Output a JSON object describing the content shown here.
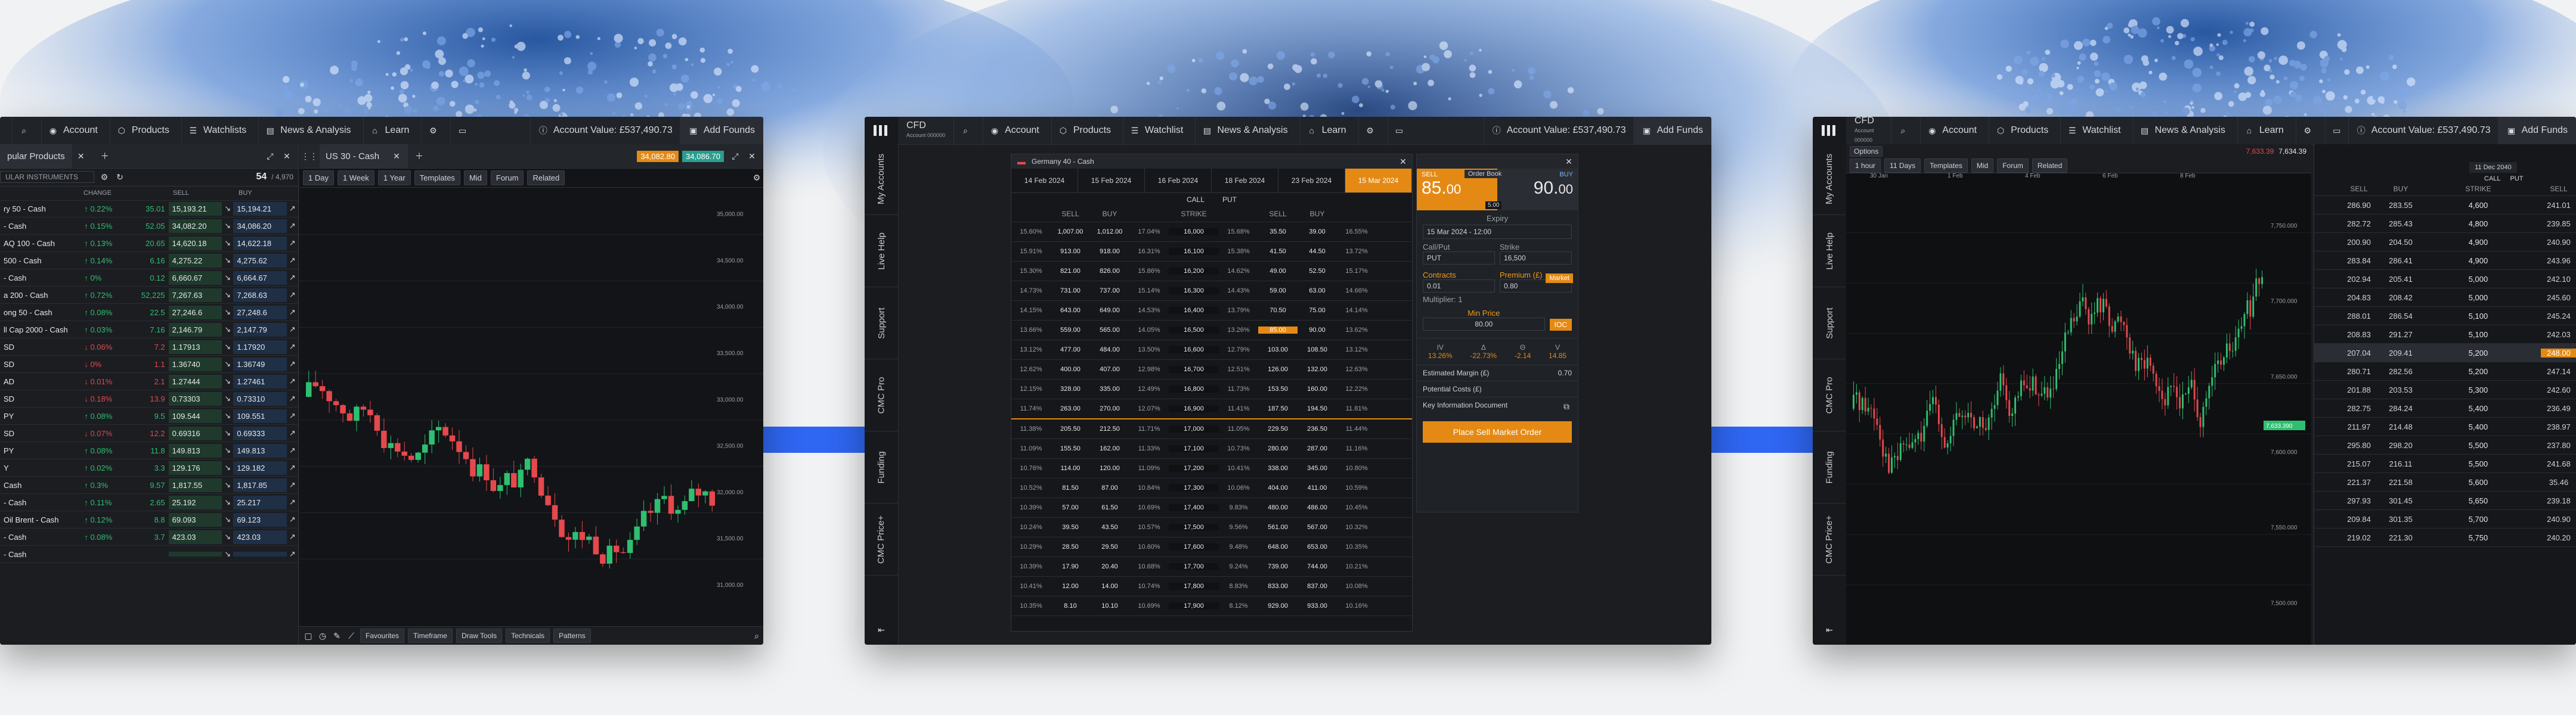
{
  "colors": {
    "background": "#f1f2f3",
    "band": "#2f66f2",
    "screen_bg": "#1b1d21",
    "up": "#2fbf71",
    "down": "#e5484d",
    "accent_orange": "#e48a14"
  },
  "icons": [
    "search-icon",
    "user-icon",
    "box-icon",
    "list-icon",
    "news-icon",
    "graduation-icon",
    "gear-icon",
    "monitor-icon",
    "info-icon",
    "funds-icon",
    "close-icon",
    "plus-icon",
    "expand-icon",
    "collapse-icon"
  ],
  "screens": {
    "left": {
      "nav": {
        "account": "Account",
        "products": "Products",
        "watchlists": "Watchlists",
        "news": "News & Analysis",
        "learn": "Learn",
        "account_value_label": "Account Value: £537,490.73",
        "add_funds": "Add Founds"
      },
      "watchlist": {
        "title": "pular Products",
        "filter": "ULAR INSTRUMENTS",
        "count": "54",
        "count_total": "/ 4,970",
        "col_change": "CHANGE",
        "col_sell": "SELL",
        "col_buy": "BUY",
        "rows": [
          {
            "name": "ry 50 - Cash",
            "pct": "0.22%",
            "chg": "35.01",
            "sell": "15,193.21",
            "buy": "15,194.21",
            "dir": "up"
          },
          {
            "name": "- Cash",
            "pct": "0.15%",
            "chg": "52.05",
            "sell": "34,082.20",
            "buy": "34,086.20",
            "dir": "up"
          },
          {
            "name": "AQ 100 - Cash",
            "pct": "0.13%",
            "chg": "20.65",
            "sell": "14,620.18",
            "buy": "14,622.18",
            "dir": "up"
          },
          {
            "name": "500 - Cash",
            "pct": "0.14%",
            "chg": "6.16",
            "sell": "4,275.22",
            "buy": "4,275.62",
            "dir": "up"
          },
          {
            "name": "- Cash",
            "pct": "0%",
            "chg": "0.12",
            "sell": "6,660.67",
            "buy": "6,664.67",
            "dir": "up"
          },
          {
            "name": "a 200 - Cash",
            "pct": "0.72%",
            "chg": "52,225",
            "sell": "7,267.63",
            "buy": "7,268.63",
            "dir": "up"
          },
          {
            "name": "ong 50 - Cash",
            "pct": "0.08%",
            "chg": "22.5",
            "sell": "27,246.6",
            "buy": "27,248.6",
            "dir": "up"
          },
          {
            "name": "ll Cap 2000 - Cash",
            "pct": "0.03%",
            "chg": "7.16",
            "sell": "2,146.79",
            "buy": "2,147.79",
            "dir": "up"
          },
          {
            "name": "SD",
            "pct": "0.06%",
            "chg": "7.2",
            "sell": "1.17913",
            "buy": "1.17920",
            "dir": "down"
          },
          {
            "name": "SD",
            "pct": "0%",
            "chg": "1.1",
            "sell": "1.36740",
            "buy": "1.36749",
            "dir": "down"
          },
          {
            "name": "AD",
            "pct": "0.01%",
            "chg": "2.1",
            "sell": "1.27444",
            "buy": "1.27461",
            "dir": "down"
          },
          {
            "name": "SD",
            "pct": "0.18%",
            "chg": "13.9",
            "sell": "0.73303",
            "buy": "0.73310",
            "dir": "down"
          },
          {
            "name": "PY",
            "pct": "0.08%",
            "chg": "9.5",
            "sell": "109.544",
            "buy": "109.551",
            "dir": "up"
          },
          {
            "name": "SD",
            "pct": "0.07%",
            "chg": "12.2",
            "sell": "0.69316",
            "buy": "0.69333",
            "dir": "down"
          },
          {
            "name": "PY",
            "pct": "0.08%",
            "chg": "11.8",
            "sell": "149.813",
            "buy": "149.813",
            "dir": "up"
          },
          {
            "name": "Y",
            "pct": "0.02%",
            "chg": "3.3",
            "sell": "129.176",
            "buy": "129.182",
            "dir": "up"
          },
          {
            "name": "Cash",
            "pct": "0.3%",
            "chg": "9.57",
            "sell": "1,817.55",
            "buy": "1,817.85",
            "dir": "up"
          },
          {
            "name": "- Cash",
            "pct": "0.11%",
            "chg": "2.65",
            "sell": "25.192",
            "buy": "25.217",
            "dir": "up"
          },
          {
            "name": "Oil Brent - Cash",
            "pct": "0.12%",
            "chg": "8.8",
            "sell": "69.093",
            "buy": "69.123",
            "dir": "up"
          },
          {
            "name": "- Cash",
            "pct": "0.08%",
            "chg": "3.7",
            "sell": "423.03",
            "buy": "423.03",
            "dir": "up"
          },
          {
            "name": "- Cash",
            "pct": "",
            "chg": "",
            "sell": "",
            "buy": "",
            "dir": "up"
          }
        ]
      },
      "chart": {
        "tab_title": "US 30 - Cash",
        "sell_price": "34,082.80",
        "buy_price": "34,086.70",
        "periods": [
          "1 Day",
          "1 Week",
          "1 Year"
        ],
        "tools": [
          "Templates",
          "Mid",
          "Forum",
          "Related"
        ],
        "bottom_tabs": [
          "Favourites",
          "Timeframe",
          "Draw Tools",
          "Technicals",
          "Patterns"
        ],
        "y_ticks": [
          "35,000.00",
          "34,500.00",
          "34,000.00",
          "33,500.00",
          "33,000.00",
          "32,500.00",
          "32,000.00",
          "31,500.00",
          "31,000.00"
        ]
      }
    },
    "center": {
      "app_name": "CFD",
      "app_sub": "Account 000000",
      "nav": {
        "account": "Account",
        "products": "Products",
        "watchlist": "Watchlist",
        "news": "News & Analysis",
        "learn": "Learn",
        "account_value_label": "Account Value: £537,490.73",
        "add_funds": "Add Funds"
      },
      "side_tabs": [
        "My Accounts",
        "Live Help",
        "Support",
        "CMC Pro",
        "Funding",
        "CMC Price+"
      ],
      "options": {
        "title": "Germany 40 - Cash",
        "expiries": [
          "14 Feb 2024",
          "15 Feb 2024",
          "16 Feb 2024",
          "18 Feb 2024",
          "23 Feb 2024",
          "15 Mar 2024"
        ],
        "call_label": "CALL",
        "put_label": "PUT",
        "col_sell": "SELL",
        "col_buy": "BUY",
        "col_strike": "STRIKE",
        "rows": [
          {
            "iv1": "15.60%",
            "csell": "1,007.00",
            "cbuy": "1,012.00",
            "iv2": "17.04%",
            "strike": "16,000",
            "iv3": "15.68%",
            "psell": "35.50",
            "pbuy": "39.00",
            "iv4": "16.55%"
          },
          {
            "iv1": "15.91%",
            "csell": "913.00",
            "cbuy": "918.00",
            "iv2": "16.31%",
            "strike": "16,100",
            "iv3": "15.38%",
            "psell": "41.50",
            "pbuy": "44.50",
            "iv4": "13.72%"
          },
          {
            "iv1": "15.30%",
            "csell": "821.00",
            "cbuy": "826.00",
            "iv2": "15.86%",
            "strike": "16,200",
            "iv3": "14.62%",
            "psell": "49.00",
            "pbuy": "52.50",
            "iv4": "15.17%"
          },
          {
            "iv1": "14.73%",
            "csell": "731.00",
            "cbuy": "737.00",
            "iv2": "15.14%",
            "strike": "16,300",
            "iv3": "14.43%",
            "psell": "59.00",
            "pbuy": "63.00",
            "iv4": "14.66%"
          },
          {
            "iv1": "14.15%",
            "csell": "643.00",
            "cbuy": "649.00",
            "iv2": "14.53%",
            "strike": "16,400",
            "iv3": "13.79%",
            "psell": "70.50",
            "pbuy": "75.00",
            "iv4": "14.14%"
          },
          {
            "iv1": "13.66%",
            "csell": "559.00",
            "cbuy": "565.00",
            "iv2": "14.05%",
            "strike": "16,500",
            "iv3": "13.26%",
            "psell": "85.00",
            "pbuy": "90.00",
            "iv4": "13.62%"
          },
          {
            "iv1": "13.12%",
            "csell": "477.00",
            "cbuy": "484.00",
            "iv2": "13.50%",
            "strike": "16,600",
            "iv3": "12.79%",
            "psell": "103.00",
            "pbuy": "108.50",
            "iv4": "13.12%"
          },
          {
            "iv1": "12.62%",
            "csell": "400.00",
            "cbuy": "407.00",
            "iv2": "12.98%",
            "strike": "16,700",
            "iv3": "12.51%",
            "psell": "126.00",
            "pbuy": "132.00",
            "iv4": "12.63%"
          },
          {
            "iv1": "12.15%",
            "csell": "328.00",
            "cbuy": "335.00",
            "iv2": "12.49%",
            "strike": "16,800",
            "iv3": "11.73%",
            "psell": "153.50",
            "pbuy": "160.00",
            "iv4": "12.22%"
          },
          {
            "iv1": "11.74%",
            "csell": "263.00",
            "cbuy": "270.00",
            "iv2": "12.07%",
            "strike": "16,900",
            "iv3": "11.41%",
            "psell": "187.50",
            "pbuy": "194.50",
            "iv4": "11.81%"
          },
          {
            "iv1": "11.38%",
            "csell": "205.50",
            "cbuy": "212.50",
            "iv2": "11.71%",
            "strike": "17,000",
            "iv3": "11.05%",
            "psell": "229.50",
            "pbuy": "236.50",
            "iv4": "11.44%"
          },
          {
            "iv1": "11.09%",
            "csell": "155.50",
            "cbuy": "162.00",
            "iv2": "11.33%",
            "strike": "17,100",
            "iv3": "10.73%",
            "psell": "280.00",
            "pbuy": "287.00",
            "iv4": "11.16%"
          },
          {
            "iv1": "10.76%",
            "csell": "114.00",
            "cbuy": "120.00",
            "iv2": "11.09%",
            "strike": "17,200",
            "iv3": "10.41%",
            "psell": "338.00",
            "pbuy": "345.00",
            "iv4": "10.80%"
          },
          {
            "iv1": "10.52%",
            "csell": "81.50",
            "cbuy": "87.00",
            "iv2": "10.84%",
            "strike": "17,300",
            "iv3": "10.06%",
            "psell": "404.00",
            "pbuy": "411.00",
            "iv4": "10.59%"
          },
          {
            "iv1": "10.39%",
            "csell": "57.00",
            "cbuy": "61.50",
            "iv2": "10.69%",
            "strike": "17,400",
            "iv3": "9.83%",
            "psell": "480.00",
            "pbuy": "486.00",
            "iv4": "10.45%"
          },
          {
            "iv1": "10.24%",
            "csell": "39.50",
            "cbuy": "43.50",
            "iv2": "10.57%",
            "strike": "17,500",
            "iv3": "9.56%",
            "psell": "561.00",
            "pbuy": "567.00",
            "iv4": "10.32%"
          },
          {
            "iv1": "10.29%",
            "csell": "28.50",
            "cbuy": "29.50",
            "iv2": "10.60%",
            "strike": "17,600",
            "iv3": "9.48%",
            "psell": "648.00",
            "pbuy": "653.00",
            "iv4": "10.35%"
          },
          {
            "iv1": "10.39%",
            "csell": "17.90",
            "cbuy": "20.40",
            "iv2": "10.68%",
            "strike": "17,700",
            "iv3": "9.24%",
            "psell": "739.00",
            "pbuy": "744.00",
            "iv4": "10.21%"
          },
          {
            "iv1": "10.41%",
            "csell": "12.00",
            "cbuy": "14.00",
            "iv2": "10.74%",
            "strike": "17,800",
            "iv3": "8.83%",
            "psell": "833.00",
            "pbuy": "837.00",
            "iv4": "10.08%"
          },
          {
            "iv1": "10.35%",
            "csell": "8.10",
            "cbuy": "10.10",
            "iv2": "10.69%",
            "strike": "17,900",
            "iv3": "8.12%",
            "psell": "929.00",
            "pbuy": "933.00",
            "iv4": "10.16%"
          }
        ]
      },
      "ticket": {
        "sell_label": "SELL",
        "buy_label": "BUY",
        "order_book": "Order Book",
        "sell_price": "85.",
        "sell_price_dec": "00",
        "buy_price": "90.",
        "buy_price_dec": "00",
        "spread": "5.00",
        "expiry_label": "Expiry",
        "expiry_value": "15 Mar 2024 - 12:00",
        "type_label": "Call/Put",
        "type_value": "PUT",
        "strike_label": "Strike",
        "strike_value": "16,500",
        "contracts_label": "Contracts",
        "contracts_value": "0.01",
        "premium_label": "Premium (£)",
        "premium_value": "0.80",
        "multiplier_label": "Multiplier: 1",
        "market_label": "Market",
        "ioc_label": "IOC",
        "min_price_label": "Min Price",
        "min_price_value": "80.00",
        "greeks_labels": [
          "IV",
          "Δ",
          "Θ",
          "V"
        ],
        "greeks_values": [
          "13.26%",
          "-22.73%",
          "-2.14",
          "14.85"
        ],
        "est_margin_label": "Estimated Margin (£)",
        "est_margin_value": "0.70",
        "potential_cost_label": "Potential Costs (£)",
        "kid_label": "Key Information Document",
        "submit": "Place Sell Market Order"
      }
    },
    "right": {
      "app_name": "CFD",
      "app_sub": "Account 000000",
      "nav": {
        "account": "Account",
        "products": "Products",
        "watchlist": "Watchlist",
        "news": "News & Analysis",
        "learn": "Learn",
        "account_value_label": "Account Value: £537,490.73",
        "add_funds": "Add Funds"
      },
      "side_tabs": [
        "My Accounts",
        "Live Help",
        "Support",
        "CMC Pro",
        "Funding",
        "CMC Price+"
      ],
      "chart": {
        "options_label": "Options",
        "periods": [
          "1 hour",
          "11 Days"
        ],
        "tools": [
          "Templates",
          "Mid",
          "Forum",
          "Related"
        ],
        "sell_price": "7,633.39",
        "buy_price": "7,634.39",
        "date_labels": [
          "30 Jan",
          "1 Feb",
          "4 Feb",
          "6 Feb",
          "8 Feb"
        ],
        "y_ticks": [
          "7,750.000",
          "7,700.000",
          "7,650.000",
          "7,600.000",
          "7,550.000",
          "7,500.000"
        ],
        "current_price_tag": "7,633.390"
      },
      "chain": {
        "expiry": "11 Dec 2040",
        "call_label": "CALL",
        "put_label": "PUT",
        "col_sell": "SELL",
        "col_buy": "BUY",
        "col_strike": "STRIKE",
        "rows": [
          {
            "csell": "286.90",
            "cbuy": "283.55",
            "strike": "4,600",
            "psell": "241.01"
          },
          {
            "csell": "282.72",
            "cbuy": "285.43",
            "strike": "4,800",
            "psell": "239.85"
          },
          {
            "csell": "200.90",
            "cbuy": "204.50",
            "strike": "4,900",
            "psell": "240.90"
          },
          {
            "csell": "283.84",
            "cbuy": "286.41",
            "strike": "4,900",
            "psell": "243.96"
          },
          {
            "csell": "202.94",
            "cbuy": "205.41",
            "strike": "5,000",
            "psell": "242.10"
          },
          {
            "csell": "204.83",
            "cbuy": "208.42",
            "strike": "5,000",
            "psell": "245.60"
          },
          {
            "csell": "288.01",
            "cbuy": "286.54",
            "strike": "5,100",
            "psell": "245.24"
          },
          {
            "csell": "208.83",
            "cbuy": "291.27",
            "strike": "5,100",
            "psell": "242.03"
          },
          {
            "csell": "207.04",
            "cbuy": "209.41",
            "strike": "5,200",
            "psell": "248.00"
          },
          {
            "csell": "280.71",
            "cbuy": "282.56",
            "strike": "5,200",
            "psell": "247.14"
          },
          {
            "csell": "201.88",
            "cbuy": "203.53",
            "strike": "5,300",
            "psell": "242.60"
          },
          {
            "csell": "282.75",
            "cbuy": "284.24",
            "strike": "5,400",
            "psell": "236.49"
          },
          {
            "csell": "211.97",
            "cbuy": "214.48",
            "strike": "5,400",
            "psell": "238.97"
          },
          {
            "csell": "295.80",
            "cbuy": "298.20",
            "strike": "5,500",
            "psell": "237.80"
          },
          {
            "csell": "215.07",
            "cbuy": "216.11",
            "strike": "5,500",
            "psell": "241.68"
          },
          {
            "csell": "221.37",
            "cbuy": "221.58",
            "strike": "5,600",
            "psell": "35.46"
          },
          {
            "csell": "297.93",
            "cbuy": "301.45",
            "strike": "5,650",
            "psell": "239.18"
          },
          {
            "csell": "209.84",
            "cbuy": "301.35",
            "strike": "5,700",
            "psell": "240.90"
          },
          {
            "csell": "219.02",
            "cbuy": "221.30",
            "strike": "5,750",
            "psell": "240.20"
          }
        ]
      }
    }
  }
}
